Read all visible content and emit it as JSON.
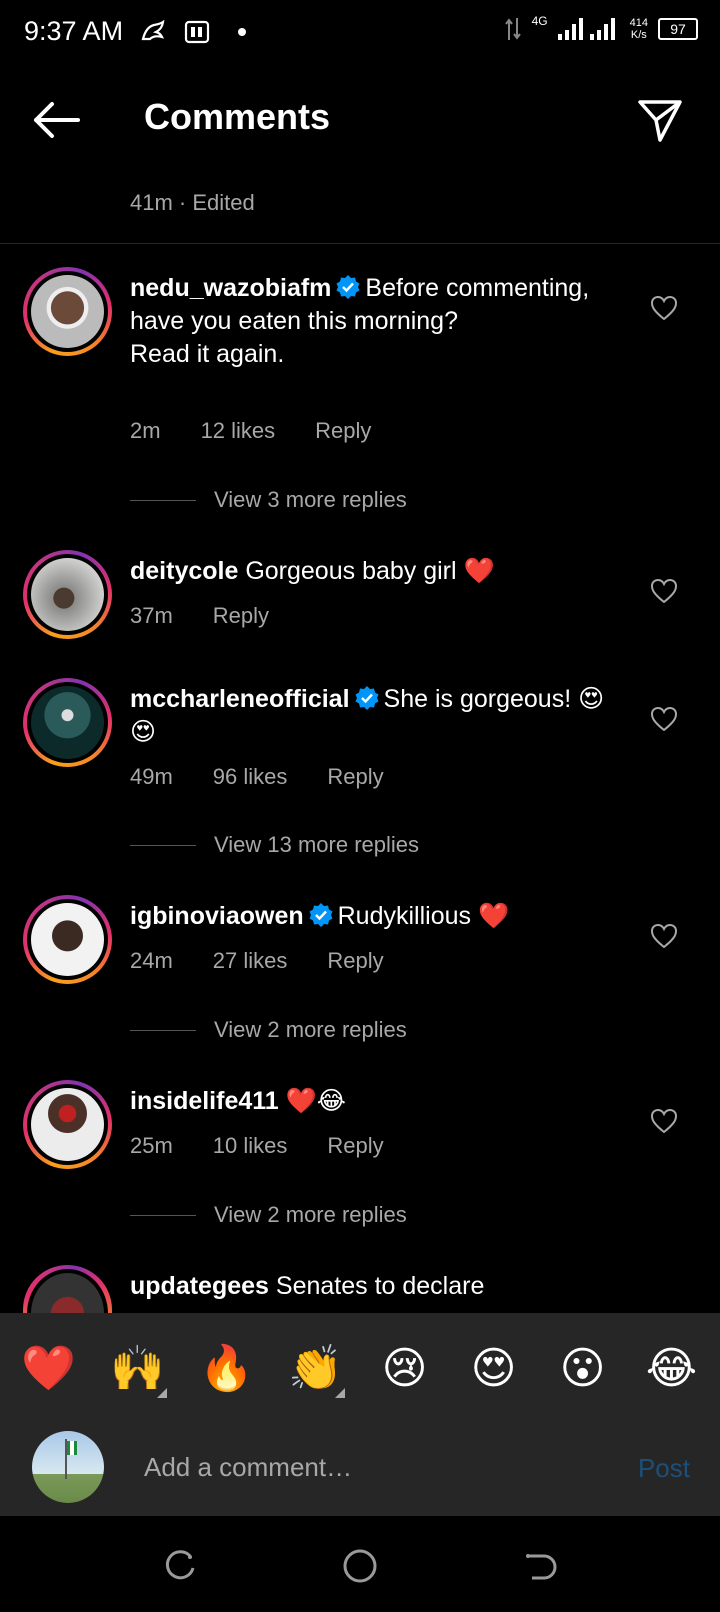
{
  "status_bar": {
    "time": "9:37 AM",
    "network": "4G",
    "speed_value": "414",
    "speed_unit": "K/s",
    "battery": "97"
  },
  "header": {
    "title": "Comments"
  },
  "previous_comment": {
    "meta": "41m · Edited"
  },
  "comments": [
    {
      "username": "nedu_wazobiafm",
      "verified": true,
      "text": "Before commenting, have you eaten this morning?",
      "text2": "Read it again.",
      "time": "2m",
      "likes": "12 likes",
      "reply": "Reply",
      "view_replies": "View 3 more replies"
    },
    {
      "username": "deitycole",
      "verified": false,
      "text": "Gorgeous baby girl ❤️",
      "time": "37m",
      "reply": "Reply"
    },
    {
      "username": "mccharleneofficial",
      "verified": true,
      "text": "She is gorgeous! 😍😍",
      "time": "49m",
      "likes": "96 likes",
      "reply": "Reply",
      "view_replies": "View 13 more replies"
    },
    {
      "username": "igbinoviaowen",
      "verified": true,
      "text": "Rudykillious ❤️",
      "time": "24m",
      "likes": "27 likes",
      "reply": "Reply",
      "view_replies": "View 2 more replies"
    },
    {
      "username": "insidelife411",
      "verified": false,
      "text": "❤️😂",
      "time": "25m",
      "likes": "10 likes",
      "reply": "Reply",
      "view_replies": "View 2 more replies"
    },
    {
      "username": "updategees",
      "verified": false,
      "text": "Senates to declare"
    }
  ],
  "emoji_bar": [
    "❤️",
    "🙌",
    "🔥",
    "👏",
    "😢",
    "😍",
    "😮",
    "😂"
  ],
  "input": {
    "placeholder": "Add a comment…",
    "post_label": "Post"
  },
  "colors": {
    "background": "#000000",
    "muted_text": "#a8a8a8",
    "verified_blue": "#0095f6",
    "post_disabled": "#1c4f7a",
    "bar_background": "#262626"
  }
}
